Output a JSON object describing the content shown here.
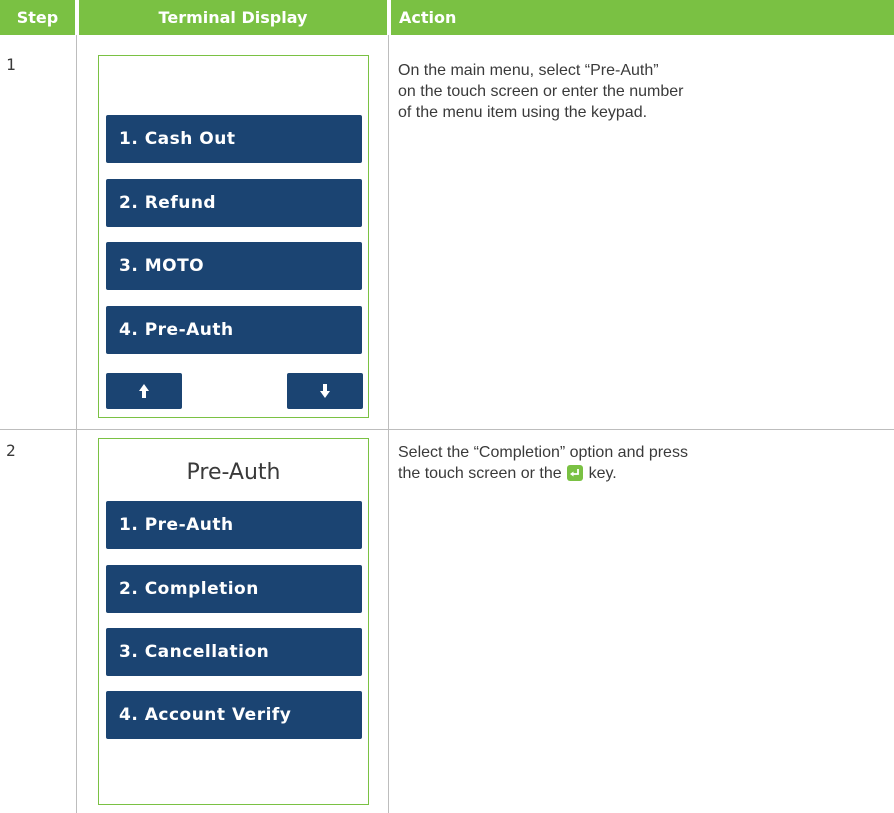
{
  "header": {
    "step": "Step",
    "terminal_display": "Terminal Display",
    "action": "Action"
  },
  "rows": [
    {
      "step": "1",
      "menu": [
        "1. Cash Out",
        "2. Refund",
        "3. MOTO",
        "4. Pre-Auth"
      ],
      "up_icon": "arrow-up-icon",
      "down_icon": "arrow-down-icon",
      "action_lines": [
        "On the main menu, select “Pre-Auth”",
        "on the touch screen or enter the number",
        "of the menu item using the keypad."
      ]
    },
    {
      "step": "2",
      "screen_title": "Pre-Auth",
      "menu": [
        "1. Pre-Auth",
        "2. Completion",
        "3. Cancellation",
        "4. Account Verify"
      ],
      "action_line1": "Select the “Completion” option and press",
      "action_line2_before": "the touch screen or the",
      "action_line2_after": "key.",
      "key_icon": "enter-key-icon"
    }
  ],
  "colors": {
    "header_green": "#7ac143",
    "button_navy": "#1b4472",
    "text_gray": "#3a3a3a",
    "grid_gray": "#bdbdbd"
  }
}
